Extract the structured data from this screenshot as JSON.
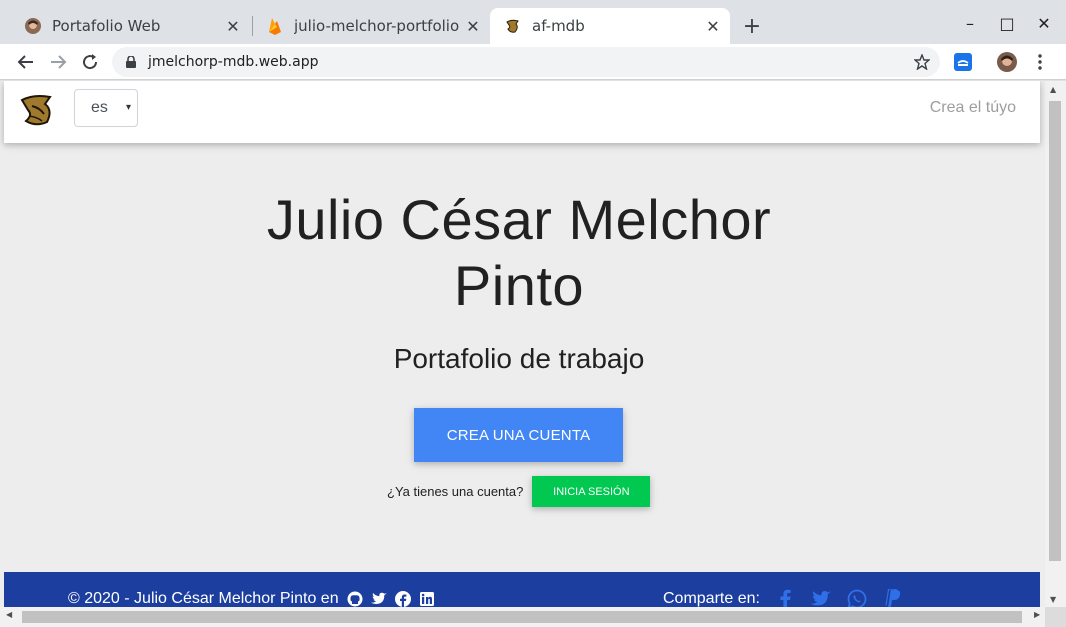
{
  "browser": {
    "tabs": [
      {
        "title": "Portafolio Web",
        "close": "✕"
      },
      {
        "title": "julio-melchor-portfolio – S",
        "close": "✕"
      },
      {
        "title": "af-mdb",
        "close": "✕"
      }
    ],
    "new_tab": "+",
    "window_controls": {
      "minimize": "–",
      "maximize": "□",
      "close": "✕"
    },
    "url": "jmelchorp-mdb.web.app",
    "icons": [
      "back-icon",
      "forward-icon",
      "reload-icon",
      "lock-icon",
      "star-icon",
      "extension-icon",
      "profile-avatar-icon",
      "menu-dots-icon"
    ]
  },
  "navbar": {
    "language_value": "es",
    "language_caret": "▾",
    "link": "Crea el túyo"
  },
  "hero": {
    "title_line1": "Julio César Melchor",
    "title_line2": "Pinto",
    "subtitle": "Portafolio de trabajo",
    "primary_button": "CREA UNA CUENTA",
    "login_question": "¿Ya tienes una cuenta?",
    "login_button": "INICIA SESIÓN"
  },
  "footer": {
    "copyright": "© 2020 - Julio César Melchor Pinto en",
    "profile_icons": [
      "github-icon",
      "twitter-icon",
      "facebook-icon",
      "linkedin-icon"
    ],
    "share_label": "Comparte en:",
    "share_icons": [
      "facebook-icon",
      "twitter-icon",
      "whatsapp-icon",
      "paypal-icon"
    ]
  },
  "colors": {
    "primary": "#4285f4",
    "success": "#00c851",
    "footer_bg": "#1c3f9f",
    "share_icon": "#2f6fe8",
    "page_bg": "#ededed"
  }
}
